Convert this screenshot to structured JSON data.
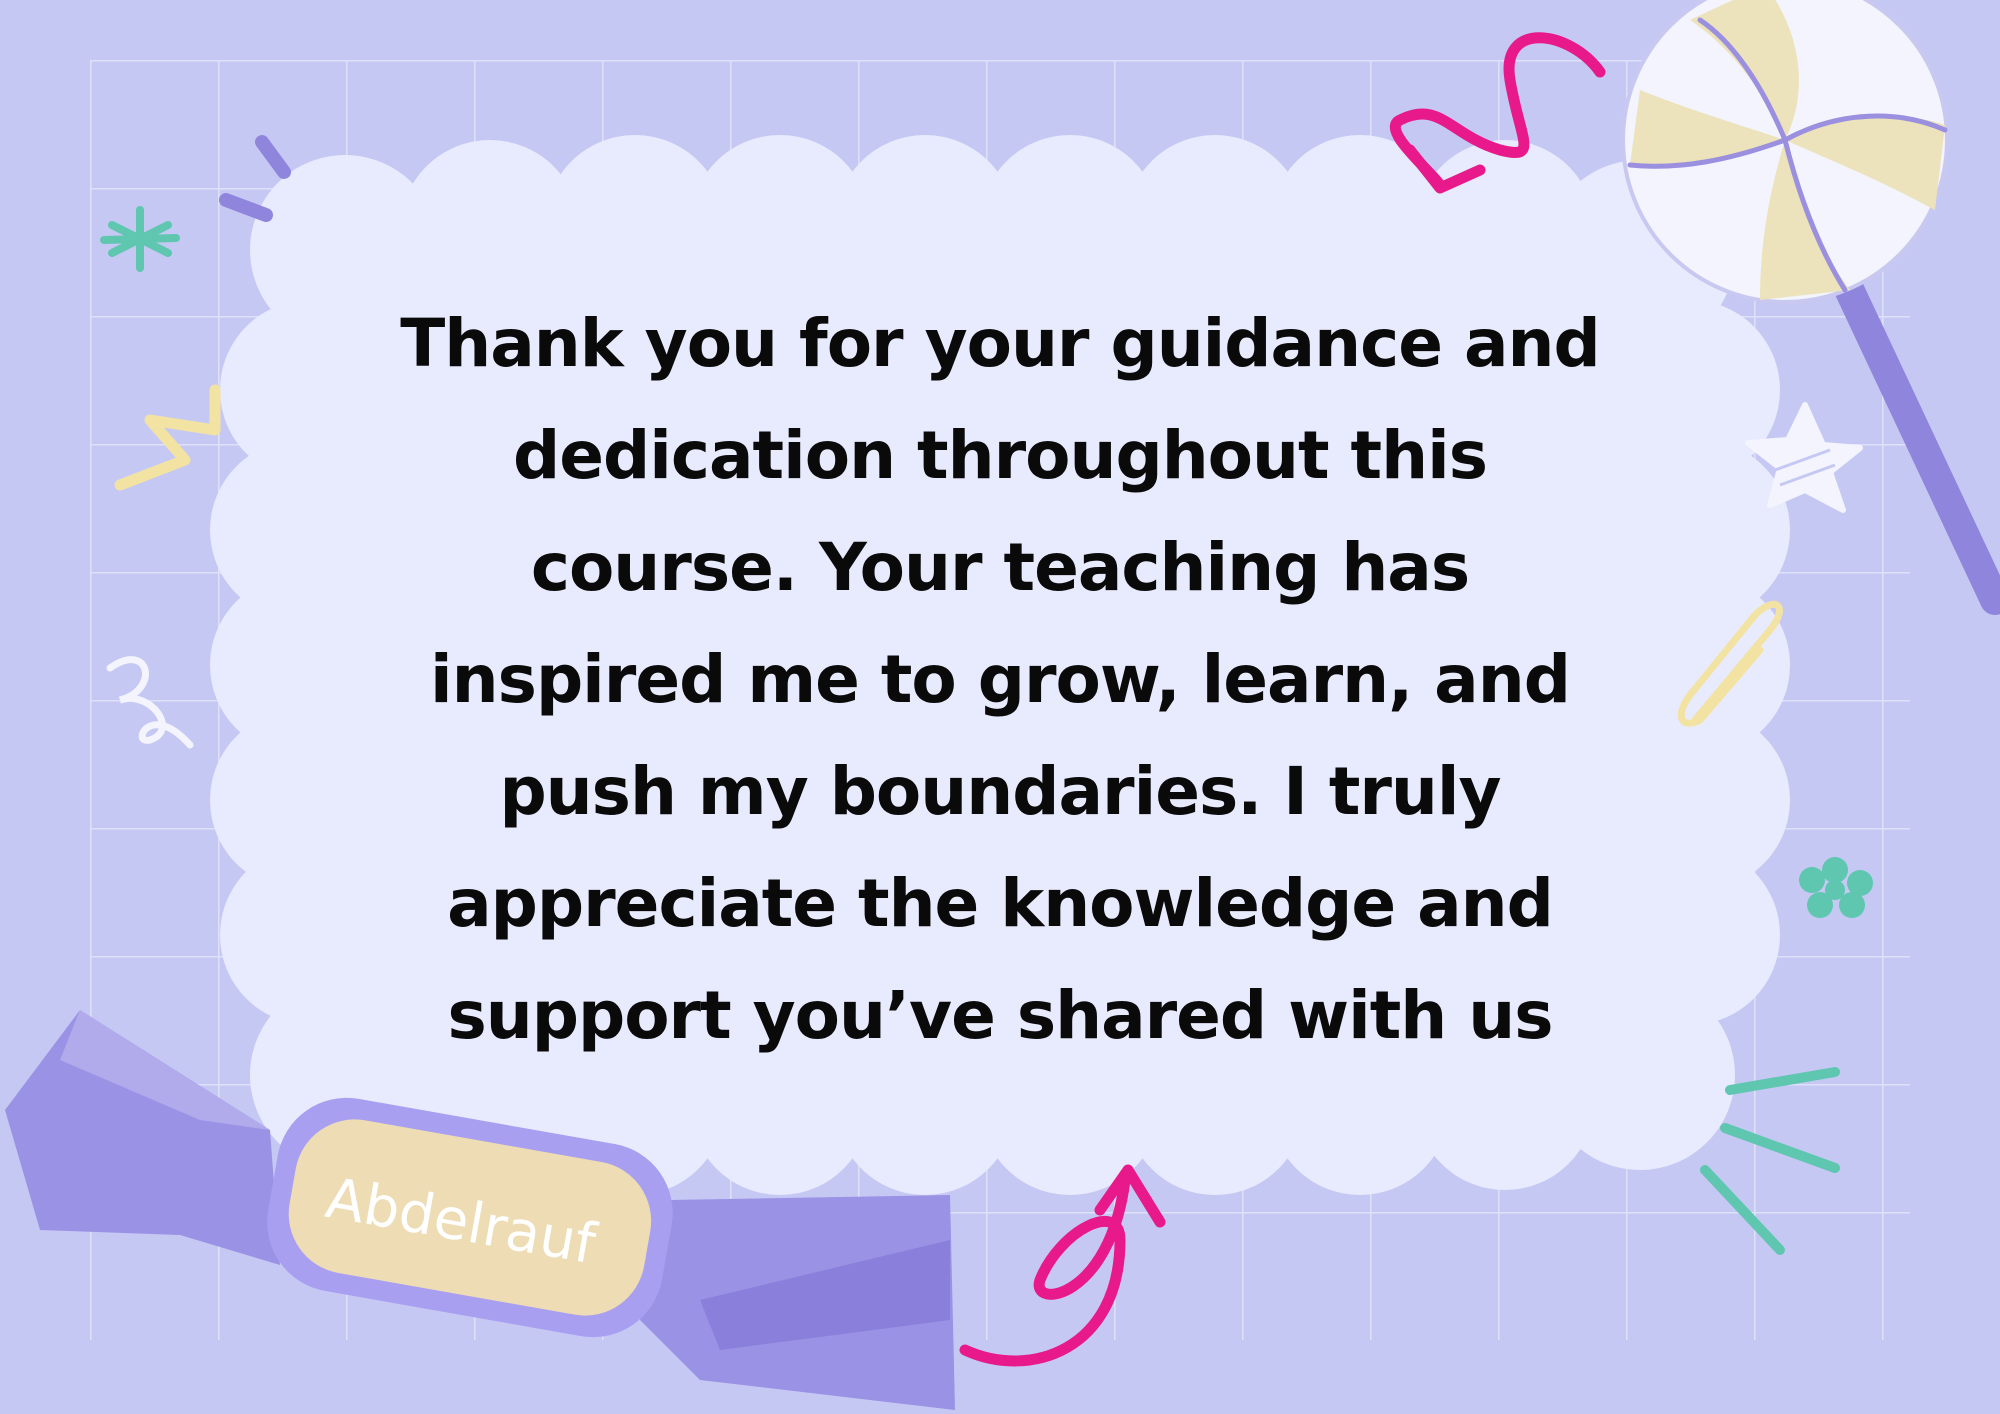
{
  "card": {
    "message": "Thank you for your guidance and dedication throughout this course. Your teaching has inspired me to grow, learn, and push my boundaries. I truly appreciate the knowledge and support you’ve shared with us",
    "candy_label": "Abdelrauf"
  },
  "colors": {
    "background": "#c6c8f4",
    "grid": "#dfe1fb",
    "cloud": "#e8eafd",
    "candy_purple": "#9a92e4",
    "candy_label": "#eddcb4",
    "accent_pink": "#e8198b",
    "accent_teal": "#5fc6b0",
    "accent_yellow": "#f3e3a3",
    "lollipop_stick": "#8f85dd",
    "text": "#0a0a0a"
  },
  "decorations": {
    "icons": [
      "lollipop-icon",
      "wrapped-candy-icon",
      "star-icon",
      "paperclip-icon",
      "sparkle-icon",
      "flower-icon",
      "arrow-icon",
      "squiggle-icon"
    ]
  }
}
